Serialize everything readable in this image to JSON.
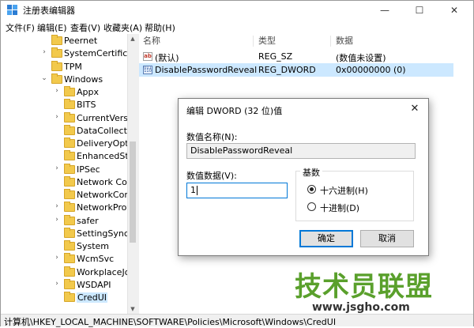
{
  "window": {
    "title": "注册表编辑器",
    "min_glyph": "—",
    "max_glyph": "☐",
    "close_glyph": "✕"
  },
  "menu": [
    "文件(F)",
    "编辑(E)",
    "查看(V)",
    "收藏夹(A)",
    "帮助(H)"
  ],
  "tree": {
    "items": [
      {
        "label": "Peernet",
        "expander": "",
        "level": 0
      },
      {
        "label": "SystemCertificates",
        "expander": ">",
        "level": 0
      },
      {
        "label": "TPM",
        "expander": "",
        "level": 0
      },
      {
        "label": "Windows",
        "expander": "v",
        "level": 0
      },
      {
        "label": "Appx",
        "expander": ">",
        "level": 1
      },
      {
        "label": "BITS",
        "expander": "",
        "level": 1
      },
      {
        "label": "CurrentVersion",
        "expander": ">",
        "level": 1
      },
      {
        "label": "DataCollection",
        "expander": "",
        "level": 1
      },
      {
        "label": "DeliveryOptimization",
        "expander": "",
        "level": 1
      },
      {
        "label": "EnhancedStorage",
        "expander": "",
        "level": 1
      },
      {
        "label": "IPSec",
        "expander": ">",
        "level": 1
      },
      {
        "label": "Network Connections",
        "expander": "",
        "level": 1
      },
      {
        "label": "NetworkConnectivity",
        "expander": "",
        "level": 1
      },
      {
        "label": "NetworkProvider",
        "expander": ">",
        "level": 1
      },
      {
        "label": "safer",
        "expander": ">",
        "level": 1
      },
      {
        "label": "SettingSync",
        "expander": "",
        "level": 1
      },
      {
        "label": "System",
        "expander": "",
        "level": 1
      },
      {
        "label": "WcmSvc",
        "expander": ">",
        "level": 1
      },
      {
        "label": "WorkplaceJoin",
        "expander": "",
        "level": 1
      },
      {
        "label": "WSDAPI",
        "expander": ">",
        "level": 1
      },
      {
        "label": "CredUI",
        "expander": "",
        "level": 1,
        "selected": true
      }
    ],
    "scroll_up": "▲",
    "scroll_down": "▼"
  },
  "list": {
    "headers": {
      "name": "名称",
      "type": "类型",
      "data": "数据"
    },
    "rows": [
      {
        "icon": "ab",
        "name": "(默认)",
        "type": "REG_SZ",
        "data": "(数值未设置)"
      },
      {
        "icon": "bin",
        "name": "DisablePasswordReveal",
        "type": "REG_DWORD",
        "data": "0x00000000 (0)",
        "selected": true
      }
    ]
  },
  "dialog": {
    "title": "编辑 DWORD (32 位)值",
    "close_glyph": "✕",
    "value_name_label": "数值名称(N):",
    "value_name": "DisablePasswordReveal",
    "value_data_label": "数值数据(V):",
    "value_data": "1",
    "base_label": "基数",
    "radio_hex": "十六进制(H)",
    "radio_dec": "十进制(D)",
    "selected_base": "hex",
    "ok_label": "确定",
    "cancel_label": "取消"
  },
  "status": {
    "path": "计算机\\HKEY_LOCAL_MACHINE\\SOFTWARE\\Policies\\Microsoft\\Windows\\CredUI"
  },
  "watermark": {
    "main": "技术员联盟",
    "url": "www.jsgho.com"
  },
  "colors": {
    "accent": "#0078d7",
    "selection": "#cce8ff",
    "folder": "#f2c94c",
    "watermark_green": "#5aa02c"
  }
}
